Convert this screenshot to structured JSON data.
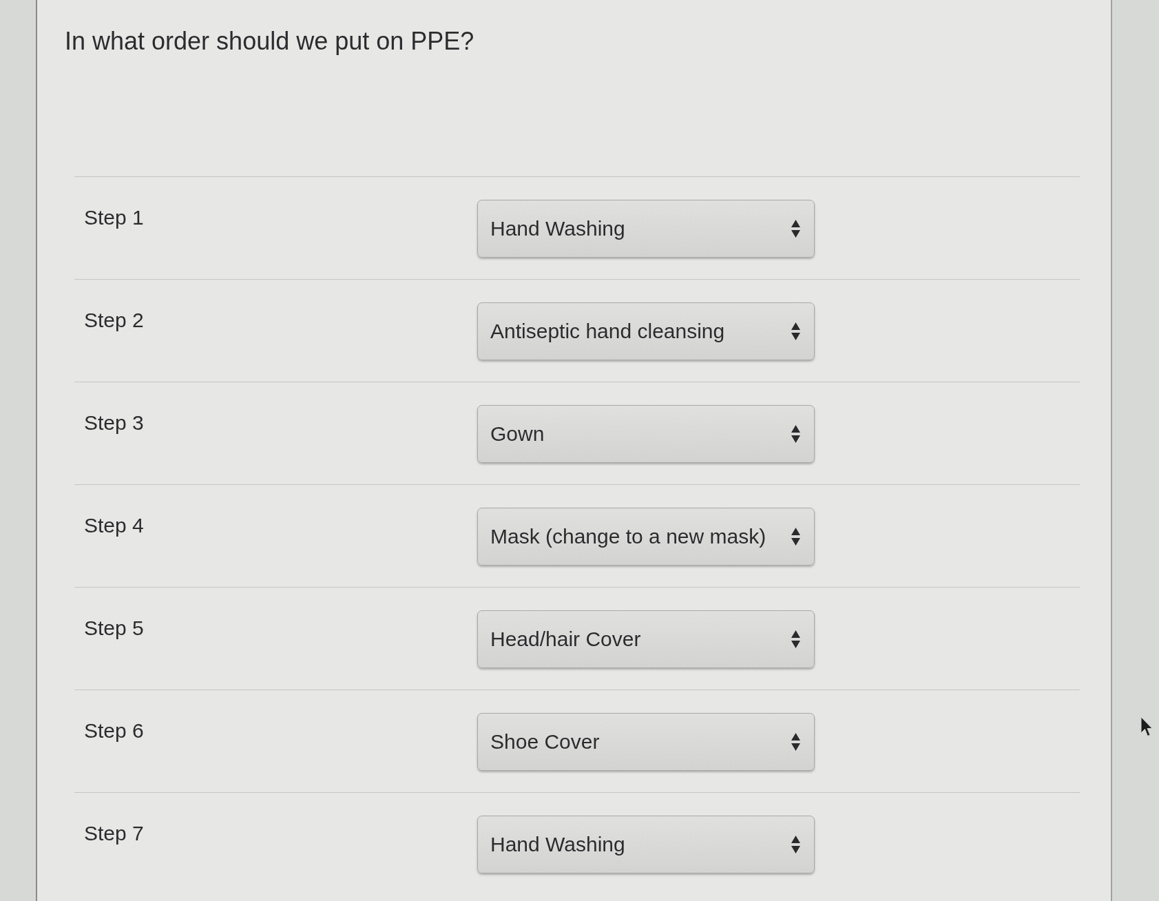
{
  "question": "In what order should we put on PPE?",
  "steps": [
    {
      "label": "Step 1",
      "value": "Hand Washing"
    },
    {
      "label": "Step 2",
      "value": "Antiseptic hand cleansing"
    },
    {
      "label": "Step 3",
      "value": "Gown"
    },
    {
      "label": "Step 4",
      "value": "Mask (change to a new mask)"
    },
    {
      "label": "Step 5",
      "value": "Head/hair Cover"
    },
    {
      "label": "Step 6",
      "value": "Shoe Cover"
    },
    {
      "label": "Step 7",
      "value": "Hand Washing"
    }
  ]
}
